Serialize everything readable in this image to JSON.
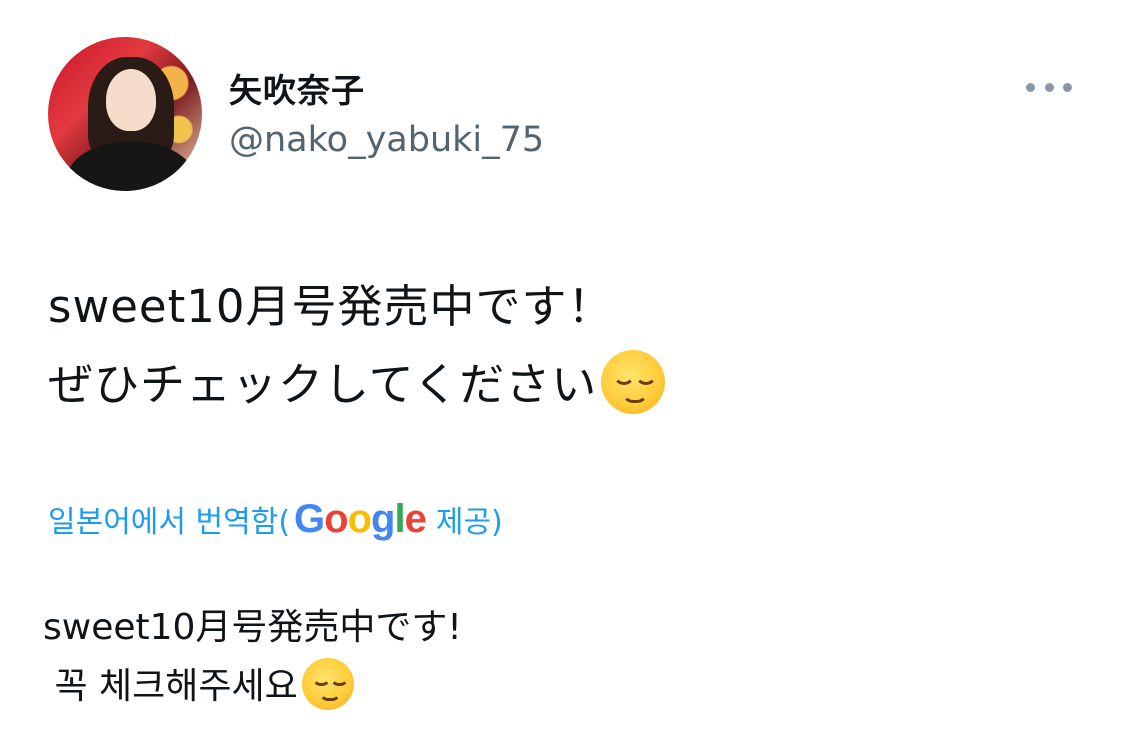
{
  "author": {
    "display_name": "矢吹奈子",
    "handle": "@nako_yabuki_75",
    "avatar_icon": "profile-photo"
  },
  "more_icon": "ellipsis-icon",
  "tweet": {
    "line1": "sweet10月号発売中です！",
    "line2": "ぜひチェックしてください",
    "emoji": "relieved-face-emoji"
  },
  "translation": {
    "prefix": "일본어에서 번역함(",
    "provider": "Google",
    "suffix": " 제공)",
    "line1": "sweet10月号発売中です!",
    "line2": " 꼭 체크해주세요",
    "colors": {
      "link": "#1d9bf0",
      "google_blue": "#4285f4",
      "google_red": "#ea4335",
      "google_yellow": "#fbbc05",
      "google_green": "#34a853"
    }
  }
}
